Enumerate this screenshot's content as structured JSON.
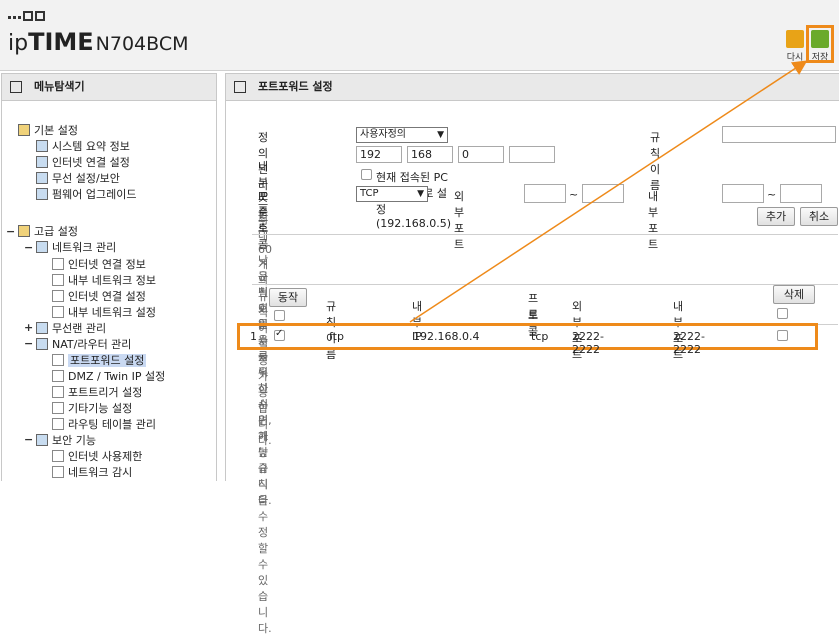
{
  "header": {
    "brand_ip": "ip",
    "brand_time": "TIME",
    "model": "N704BCM",
    "redo_label": "다시",
    "save_label": "저장"
  },
  "sidebar": {
    "title": "메뉴탐색기",
    "basic": {
      "label": "기본 설정",
      "items": [
        "시스템 요약 정보",
        "인터넷 연결 설정",
        "무선 설정/보안",
        "펌웨어 업그레이드"
      ]
    },
    "advanced": {
      "label": "고급 설정",
      "network": {
        "label": "네트워크 관리",
        "items": [
          "인터넷 연결 정보",
          "내부 네트워크 정보",
          "인터넷 연결 설정",
          "내부 네트워크 설정"
        ]
      },
      "wireless": {
        "label": "무선랜 관리"
      },
      "nat": {
        "label": "NAT/라우터 관리",
        "items": [
          "포트포워드 설정",
          "DMZ / Twin IP 설정",
          "포트트리거 설정",
          "기타기능 설정",
          "라우팅 테이블 관리"
        ]
      },
      "security": {
        "label": "보안 기능",
        "items": [
          "인터넷 사용제한",
          "네트워크 감시"
        ]
      }
    }
  },
  "main": {
    "title": "포트포워드 설정",
    "form": {
      "preset_label": "정의된 리스트",
      "preset_value": "사용자정의",
      "rule_name_label": "규칙이름",
      "rule_name_value": "",
      "internal_ip_label": "내부 IP주소",
      "ip1": "192",
      "ip2": "168",
      "ip3": "0",
      "ip4": "",
      "current_pc_label": "현재 접속된 PC의 IP 주소로 설정(192.168.0.5)",
      "protocol_label": "프로토콜",
      "protocol_value": "TCP",
      "external_port_label": "외부 포트",
      "ext_from": "",
      "ext_to": "",
      "internal_port_label": "내부 포트",
      "int_from": "",
      "int_to": "",
      "tilde": "~",
      "max_rules_note": "최대 60개의 규칙이 설정 가능합니다.",
      "add_button": "추가",
      "cancel_button": "취소"
    },
    "notes": [
      "낮은 번호일수록 우선순위가 높습니다.",
      "규칙이름을 클릭하시면, 해당 규칙을 수정할 수 있습니다."
    ],
    "table": {
      "action_button": "동작",
      "delete_button": "삭제",
      "col_rule_name": "규칙이름",
      "col_internal_ip": "내부 IP",
      "col_protocol_1": "프로",
      "col_protocol_2": "토콜",
      "col_external_port": "외부 포트",
      "col_internal_port": "내부 포트",
      "rows": [
        {
          "no": "1",
          "enabled": true,
          "name": "ftp",
          "ip": "192.168.0.4",
          "protocol": "tcp",
          "ext_port": "2222-2222",
          "int_port": "2222-2222",
          "delete": false
        }
      ]
    }
  },
  "colors": {
    "highlight": "#ee8a1a",
    "selected": "#c9d9f2"
  }
}
